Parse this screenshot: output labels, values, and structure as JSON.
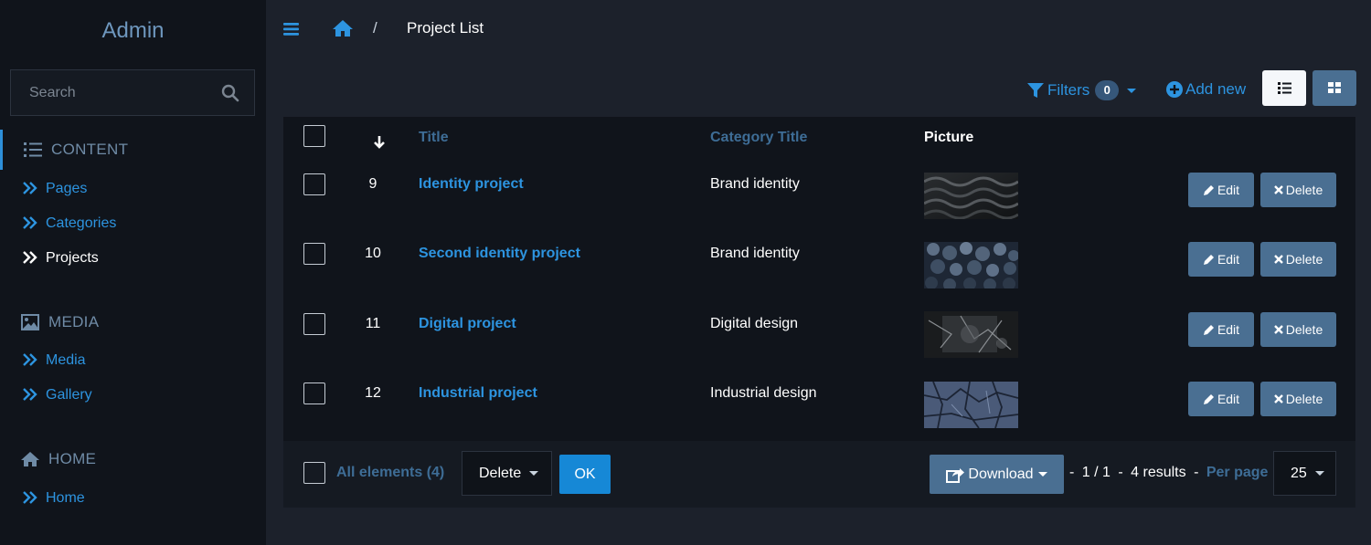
{
  "sidebar": {
    "brand": "Admin",
    "search_placeholder": "Search",
    "sections": [
      {
        "label": "CONTENT",
        "icon": "list-icon",
        "items": [
          {
            "label": "Pages"
          },
          {
            "label": "Categories"
          },
          {
            "label": "Projects",
            "current": true
          }
        ]
      },
      {
        "label": "MEDIA",
        "icon": "image-icon",
        "items": [
          {
            "label": "Media"
          },
          {
            "label": "Gallery"
          }
        ]
      },
      {
        "label": "HOME",
        "icon": "home-icon",
        "items": [
          {
            "label": "Home"
          }
        ]
      }
    ]
  },
  "header": {
    "breadcrumb_separator": "/",
    "breadcrumb_current": "Project List"
  },
  "toolbar": {
    "filters_label": "Filters",
    "filters_count": "0",
    "add_new_label": "Add new"
  },
  "table": {
    "columns": {
      "title": "Title",
      "category": "Category Title",
      "picture": "Picture"
    },
    "rows": [
      {
        "id": "9",
        "title": "Identity project",
        "category": "Brand identity",
        "picture": "dark-waves-texture"
      },
      {
        "id": "10",
        "title": "Second identity project",
        "category": "Brand identity",
        "picture": "blue-rocks-texture"
      },
      {
        "id": "11",
        "title": "Digital project",
        "category": "Digital design",
        "picture": "grunge-texture"
      },
      {
        "id": "12",
        "title": "Industrial project",
        "category": "Industrial design",
        "picture": "cracked-blue-texture"
      }
    ],
    "edit_label": "Edit",
    "delete_label": "Delete"
  },
  "footer": {
    "all_elements_label": "All elements (4)",
    "batch_action_value": "Delete",
    "ok_label": "OK",
    "download_label": "Download",
    "pager_prefix": "-",
    "pager_pages": "1 / 1",
    "pager_sep": "-",
    "pager_results": "4 results",
    "pager_sep2": "-",
    "per_page_label": "Per page",
    "per_page_value": "25"
  },
  "colors": {
    "accent": "#2d94e0",
    "button": "#4a6f92",
    "sidebar_bg": "#10141b",
    "page_bg": "#1c212b"
  }
}
